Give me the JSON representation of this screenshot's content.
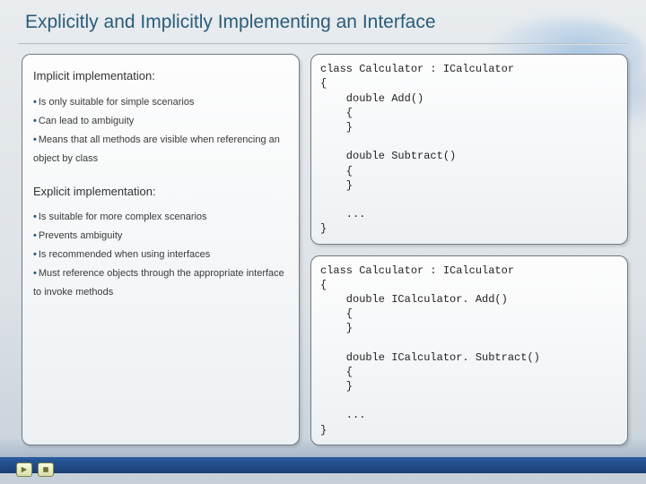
{
  "title": "Explicitly and Implicitly Implementing an Interface",
  "implicit": {
    "heading": "Implicit implementation:",
    "bullets": [
      "Is only suitable for simple scenarios",
      "Can lead to ambiguity",
      "Means that all methods are visible when referencing an object by class"
    ]
  },
  "explicit": {
    "heading": "Explicit implementation:",
    "bullets": [
      "Is suitable for more complex scenarios",
      "Prevents ambiguity",
      "Is recommended when using interfaces",
      "Must reference objects through the appropriate interface to invoke methods"
    ]
  },
  "code1": "class Calculator : ICalculator\n{\n    double Add()\n    {\n    }\n\n    double Subtract()\n    {\n    }\n\n    ...\n}",
  "code2": "class Calculator : ICalculator\n{\n    double ICalculator. Add()\n    {\n    }\n\n    double ICalculator. Subtract()\n    {\n    }\n\n    ...\n}",
  "controls": {
    "play": "play-icon",
    "stop": "stop-icon"
  }
}
